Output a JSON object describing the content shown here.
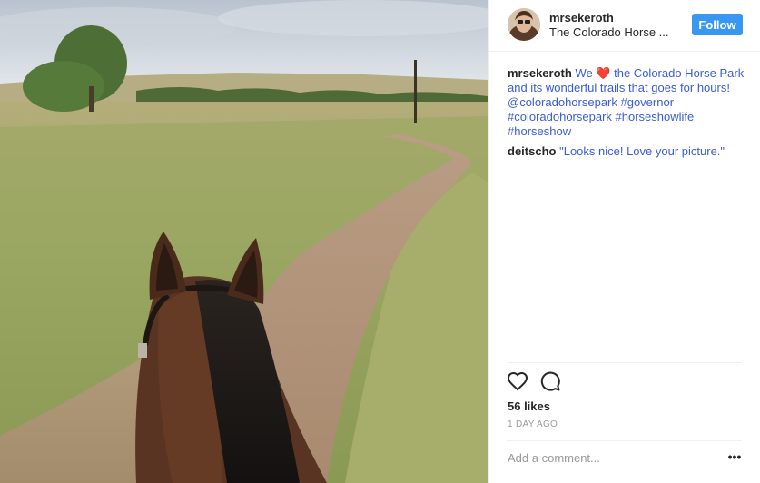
{
  "post": {
    "image_alt": "View between a horse's ears down a dirt trail through a grassy field",
    "author": {
      "username": "mrsekeroth",
      "location": "The Colorado Horse ..."
    },
    "follow_label": "Follow",
    "caption": {
      "username": "mrsekeroth",
      "text_before": "We",
      "emoji": "❤️",
      "text_after": " the Colorado Horse Park and its wonderful trails that goes for hours! @coloradohorsepark #governor #coloradohorsepark #horseshowlife #horseshow"
    },
    "comments": [
      {
        "username": "deitscho",
        "text": "\"Looks nice! Love your picture.\""
      }
    ],
    "likes": "56 likes",
    "time_ago": "1 DAY AGO",
    "add_comment_placeholder": "Add a comment...",
    "more_glyph": "•••"
  },
  "colors": {
    "follow_bg": "#3897f0",
    "link_text": "#3a5bd8",
    "heart": "#e8332b"
  },
  "icons": [
    "heart-icon",
    "comment-icon",
    "more-options-icon"
  ]
}
